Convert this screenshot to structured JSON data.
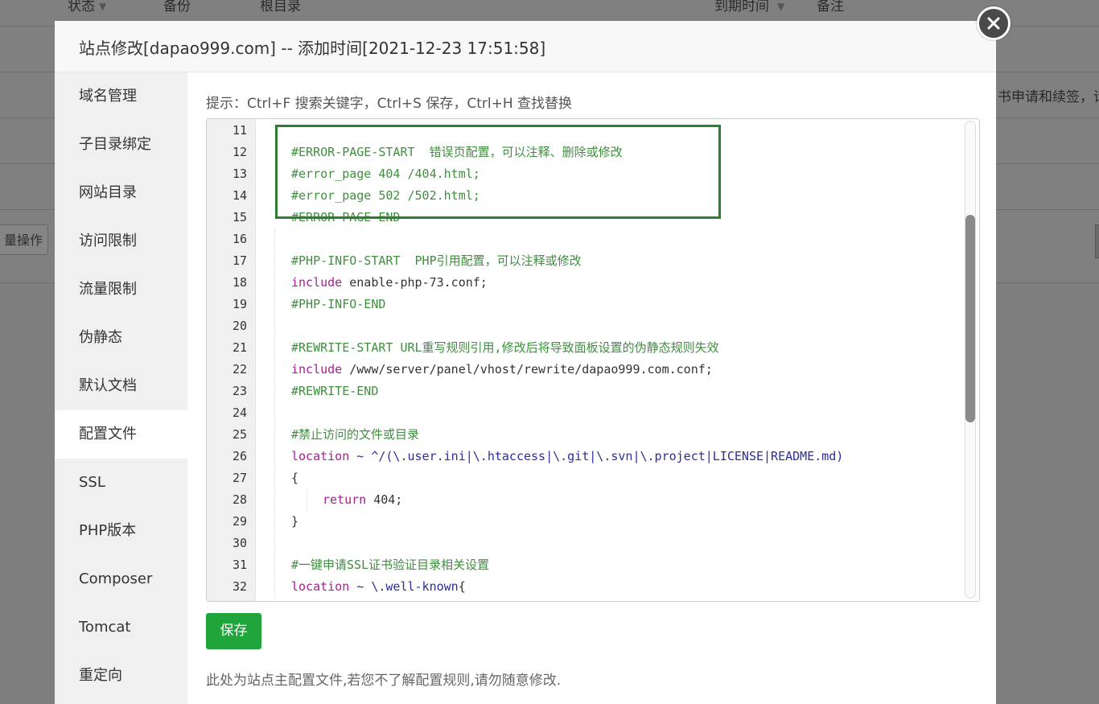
{
  "background": {
    "headers": [
      "状态",
      "备份",
      "根目录",
      "到期时间",
      "备注"
    ],
    "batch_button": "量操作",
    "right_text": "书申请和续签，请"
  },
  "modal": {
    "title": "站点修改[dapao999.com] -- 添加时间[2021-12-23 17:51:58]",
    "sidebar": [
      "域名管理",
      "子目录绑定",
      "网站目录",
      "访问限制",
      "流量限制",
      "伪静态",
      "默认文档",
      "配置文件",
      "SSL",
      "PHP版本",
      "Composer",
      "Tomcat",
      "重定向"
    ],
    "active_item": "配置文件",
    "tip": "提示：Ctrl+F 搜索关键字，Ctrl+S 保存，Ctrl+H 查找替换",
    "save_label": "保存",
    "note": "此处为站点主配置文件,若您不了解配置规则,请勿随意修改.",
    "highlight_color": "#2e7d32",
    "accent_color": "#20a53a"
  },
  "editor": {
    "lines": [
      {
        "n": "11",
        "t": ""
      },
      {
        "n": "12",
        "t": "#ERROR-PAGE-START  错误页配置，可以注释、删除或修改"
      },
      {
        "n": "13",
        "t": "#error_page 404 /404.html;"
      },
      {
        "n": "14",
        "t": "#error_page 502 /502.html;"
      },
      {
        "n": "15",
        "t": "#ERROR-PAGE-END"
      },
      {
        "n": "16",
        "t": ""
      },
      {
        "n": "17",
        "t": "#PHP-INFO-START  PHP引用配置，可以注释或修改"
      },
      {
        "n": "18",
        "t": "include enable-php-73.conf;"
      },
      {
        "n": "19",
        "t": "#PHP-INFO-END"
      },
      {
        "n": "20",
        "t": ""
      },
      {
        "n": "21",
        "t": "#REWRITE-START URL重写规则引用,修改后将导致面板设置的伪静态规则失效"
      },
      {
        "n": "22",
        "t": "include /www/server/panel/vhost/rewrite/dapao999.com.conf;"
      },
      {
        "n": "23",
        "t": "#REWRITE-END"
      },
      {
        "n": "24",
        "t": ""
      },
      {
        "n": "25",
        "t": "#禁止访问的文件或目录"
      },
      {
        "n": "26",
        "t": "location ~ ^/(\\.user.ini|\\.htaccess|\\.git|\\.svn|\\.project|LICENSE|README.md)"
      },
      {
        "n": "27",
        "t": "{"
      },
      {
        "n": "28",
        "t": "return 404;"
      },
      {
        "n": "29",
        "t": "}"
      },
      {
        "n": "30",
        "t": ""
      },
      {
        "n": "31",
        "t": "#一键申请SSL证书验证目录相关设置"
      },
      {
        "n": "32",
        "t": "location ~ \\.well-known{"
      }
    ]
  }
}
